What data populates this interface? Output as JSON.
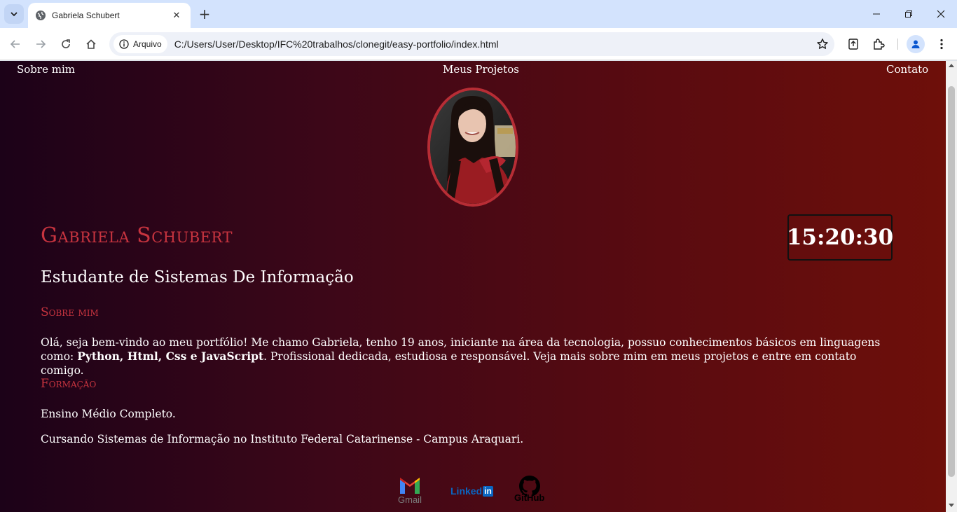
{
  "browser": {
    "tab_title": "Gabriela Schubert",
    "chip_label": "Arquivo",
    "url": "C:/Users/User/Desktop/IFC%20trabalhos/clonegit/easy-portfolio/index.html",
    "new_tab": "+",
    "close": "✕"
  },
  "nav": {
    "about": "Sobre mim",
    "projects": "Meus Projetos",
    "contact": "Contato"
  },
  "hero": {
    "name": "Gabriela Schubert",
    "clock": "15:20:30",
    "subtitle": "Estudante de Sistemas De Informação"
  },
  "about": {
    "heading": "Sobre mim",
    "text_line1": "Olá, seja bem-vindo ao meu portfólio! Me chamo Gabriela, tenho 19 anos, iniciante na área da tecnologia, possuo conhecimentos básicos em linguagens como:",
    "skills": "Python, Html, Css e JavaScript",
    "text_line2": ". Profissional dedicada, estudiosa e responsável. Veja mais sobre mim em meus projetos e entre em contato comigo."
  },
  "education": {
    "heading": "Formação",
    "item1": "Ensino Médio Completo.",
    "item2": "Cursando Sistemas de Informação no Instituto Federal Catarinense - Campus Araquari."
  },
  "social": {
    "gmail": "Gmail",
    "linkedin": "Linked",
    "linkedin_in": "in",
    "github": "GitHub"
  },
  "colors": {
    "accent": "#c7343f",
    "frame": "#b72d35",
    "gradient_start": "#1c0218",
    "gradient_end": "#6e0f0a"
  }
}
